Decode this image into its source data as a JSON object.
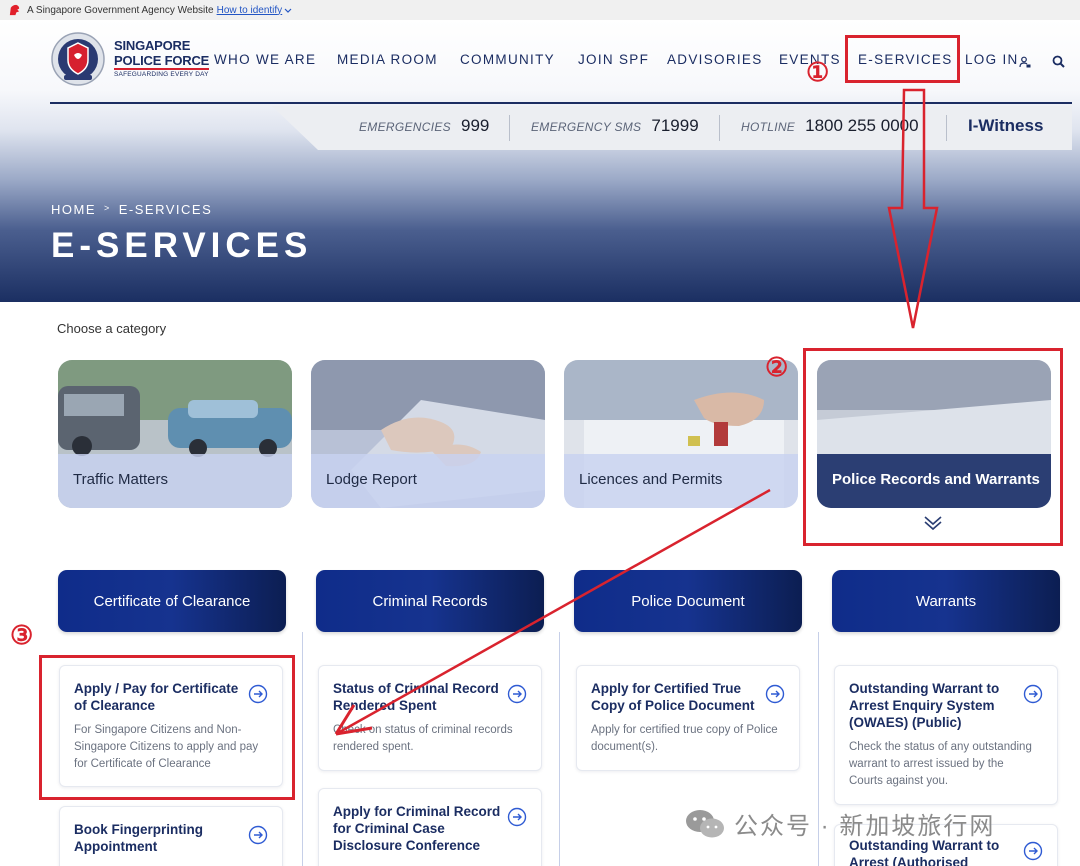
{
  "gov_banner": {
    "text": "A Singapore Government Agency Website",
    "link": "How to identify"
  },
  "logo": {
    "line1": "SINGAPORE",
    "line2": "POLICE FORCE",
    "tagline": "SAFEGUARDING EVERY DAY"
  },
  "nav": {
    "items": [
      "WHO WE ARE",
      "MEDIA ROOM",
      "COMMUNITY",
      "JOIN SPF",
      "ADVISORIES",
      "EVENTS",
      "E-SERVICES",
      "LOG IN"
    ],
    "icons": [
      "user-lock-icon",
      "search-icon"
    ]
  },
  "hotlines": [
    {
      "label": "EMERGENCIES",
      "number": "999"
    },
    {
      "label": "EMERGENCY SMS",
      "number": "71999"
    },
    {
      "label": "HOTLINE",
      "number": "1800 255 0000"
    }
  ],
  "witness": "I-Witness",
  "breadcrumb": [
    "HOME",
    "E-SERVICES"
  ],
  "page_title": "E-SERVICES",
  "choose_label": "Choose a category",
  "categories": [
    {
      "label": "Traffic Matters"
    },
    {
      "label": "Lodge Report"
    },
    {
      "label": "Licences and Permits"
    },
    {
      "label": "Police Records and Warrants",
      "selected": true
    }
  ],
  "subcategories": [
    "Certificate of Clearance",
    "Criminal Records",
    "Police Document",
    "Warrants"
  ],
  "services": {
    "col1": [
      {
        "title": "Apply / Pay for Certificate of Clearance",
        "desc": "For Singapore Citizens and Non-Singapore Citizens to apply and pay for Certificate of Clearance"
      },
      {
        "title": "Book Fingerprinting Appointment",
        "desc": ""
      }
    ],
    "col2": [
      {
        "title": "Status of Criminal Record Rendered Spent",
        "desc": "Check on status of criminal records rendered spent."
      },
      {
        "title": "Apply for Criminal Record for Criminal Case Disclosure Conference",
        "desc": ""
      }
    ],
    "col3": [
      {
        "title": "Apply for Certified True Copy of Police Document",
        "desc": "Apply for certified true copy of Police document(s)."
      }
    ],
    "col4": [
      {
        "title": "Outstanding Warrant to Arrest Enquiry System (OWAES) (Public)",
        "desc": "Check the status of any outstanding warrant to arrest issued by the Courts against you."
      },
      {
        "title": "Outstanding Warrant to Arrest (Authorised Agency",
        "desc": ""
      }
    ]
  },
  "annotations": {
    "step1": "①",
    "step2": "②",
    "step3": "③"
  },
  "watermark": "公众号 · 新加坡旅行网",
  "colors": {
    "brand_navy": "#1b2d62",
    "header_blue": "#16338f",
    "annotation_red": "#d9232e",
    "link_blue": "#2255c4"
  }
}
